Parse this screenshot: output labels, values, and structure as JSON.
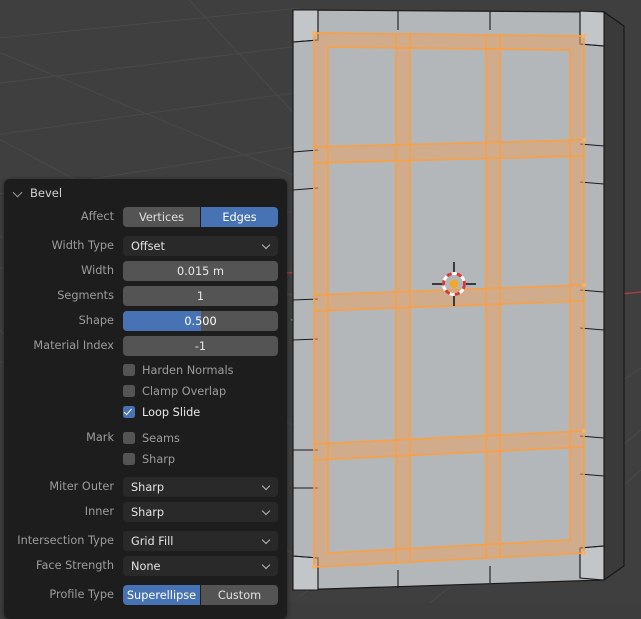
{
  "viewport": {
    "name": "3d-viewport",
    "background_color": "#3f3f3f",
    "grid_color": "#4a4a4a",
    "mesh_face_color": "#b4b7ba",
    "mesh_side_color": "#8f9295",
    "mesh_edge_color": "#1a1a1a",
    "bevel_highlight_color": "#f5a04a",
    "bevel_fill_color": "#e9a96b",
    "axis_x_color": "#a33f48",
    "axis_y_color": "#6b9e3f",
    "cursor_name": "3d-cursor"
  },
  "panel": {
    "title": "Bevel",
    "collapse_icon": "chevron-down-icon",
    "affect": {
      "label": "Affect",
      "options": [
        "Vertices",
        "Edges"
      ],
      "selected": "Edges"
    },
    "width_type": {
      "label": "Width Type",
      "value": "Offset"
    },
    "width": {
      "label": "Width",
      "value": "0.015 m"
    },
    "segments": {
      "label": "Segments",
      "value": "1"
    },
    "shape": {
      "label": "Shape",
      "value": "0.500",
      "fill_percent": 50
    },
    "material_index": {
      "label": "Material Index",
      "value": "-1"
    },
    "checkboxes": [
      {
        "label": "Harden Normals",
        "checked": false,
        "row_label": ""
      },
      {
        "label": "Clamp Overlap",
        "checked": false,
        "row_label": ""
      },
      {
        "label": "Loop Slide",
        "checked": true,
        "row_label": ""
      },
      {
        "label": "Seams",
        "checked": false,
        "row_label": "Mark"
      },
      {
        "label": "Sharp",
        "checked": false,
        "row_label": ""
      }
    ],
    "miter_outer": {
      "label": "Miter Outer",
      "value": "Sharp"
    },
    "miter_inner": {
      "label": "Inner",
      "value": "Sharp"
    },
    "intersection_type": {
      "label": "Intersection Type",
      "value": "Grid Fill"
    },
    "face_strength": {
      "label": "Face Strength",
      "value": "None"
    },
    "profile_type": {
      "label": "Profile Type",
      "options": [
        "Superellipse",
        "Custom"
      ],
      "selected": "Superellipse"
    }
  }
}
